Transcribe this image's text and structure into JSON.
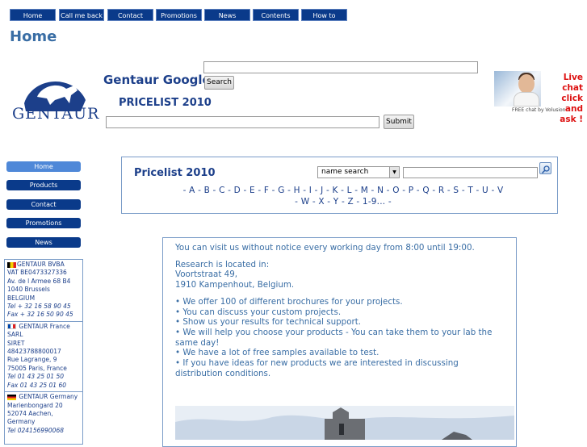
{
  "top_nav": [
    "Home",
    "Call me back",
    "Contact",
    "Promotions",
    "News",
    "Contents",
    "How to order?"
  ],
  "page_title": "Home",
  "logo": {
    "text": "GENTAUR"
  },
  "google_search": {
    "label": "Gentaur Google",
    "button": "Search"
  },
  "pricelist_search": {
    "label": "PRICELIST 2010",
    "button": "Submit"
  },
  "live_chat": {
    "text_line1": "Live chat",
    "text_line2": "click and",
    "text_line3": "ask !",
    "caption": "FREE chat by Volusion"
  },
  "side_nav": [
    "Home",
    "Products",
    "Contact",
    "Promotions",
    "News"
  ],
  "addresses": {
    "be": {
      "name": "GENTAUR BVBA",
      "lines": [
        "VAT BE0473327336",
        "Av. de l Armee 68 B4",
        "1040 Brussels",
        "BELGIUM"
      ],
      "tel": "Tel + 32 16 58 90 45",
      "fax": "Fax + 32 16 50 90 45"
    },
    "fr": {
      "name": "GENTAUR France",
      "lines": [
        "SARL",
        "SIRET",
        "48423788800017",
        "Rue Lagrange, 9",
        "75005 Paris, France"
      ],
      "tel": "Tel 01 43 25 01 50",
      "fax": "Fax 01 43 25 01 60"
    },
    "de": {
      "name": "GENTAUR Germany",
      "lines": [
        "Marienbongard 20",
        "52074 Aachen,",
        "Germany"
      ],
      "tel": "Tel 024156990068"
    }
  },
  "pricelist_box": {
    "title": "Pricelist 2010",
    "select_value": "name search",
    "letters_line1": "- A - B - C - D - E - F - G - H - I - J - K - L - M - N - O - P - Q - R - S - T - U - V",
    "letters_line2": "- W - X - Y - Z - 1-9... -"
  },
  "content": {
    "p1": "You can visit us without notice every working day from 8:00 until 19:00.",
    "p2_1": "Research is located in:",
    "p2_2": "Voortstraat 49,",
    "p2_3": "1910 Kampenhout, Belgium.",
    "bullets": [
      "We offer 100 of different brochures for your projects.",
      "You can discuss your custom projects.",
      "Show us your results for technical support.",
      "We will help you choose your products - You can take them to your lab the same day!",
      "We have a lot of free samples available to test.",
      "If you have ideas for new products we are interested in discussing distribution conditions."
    ]
  }
}
